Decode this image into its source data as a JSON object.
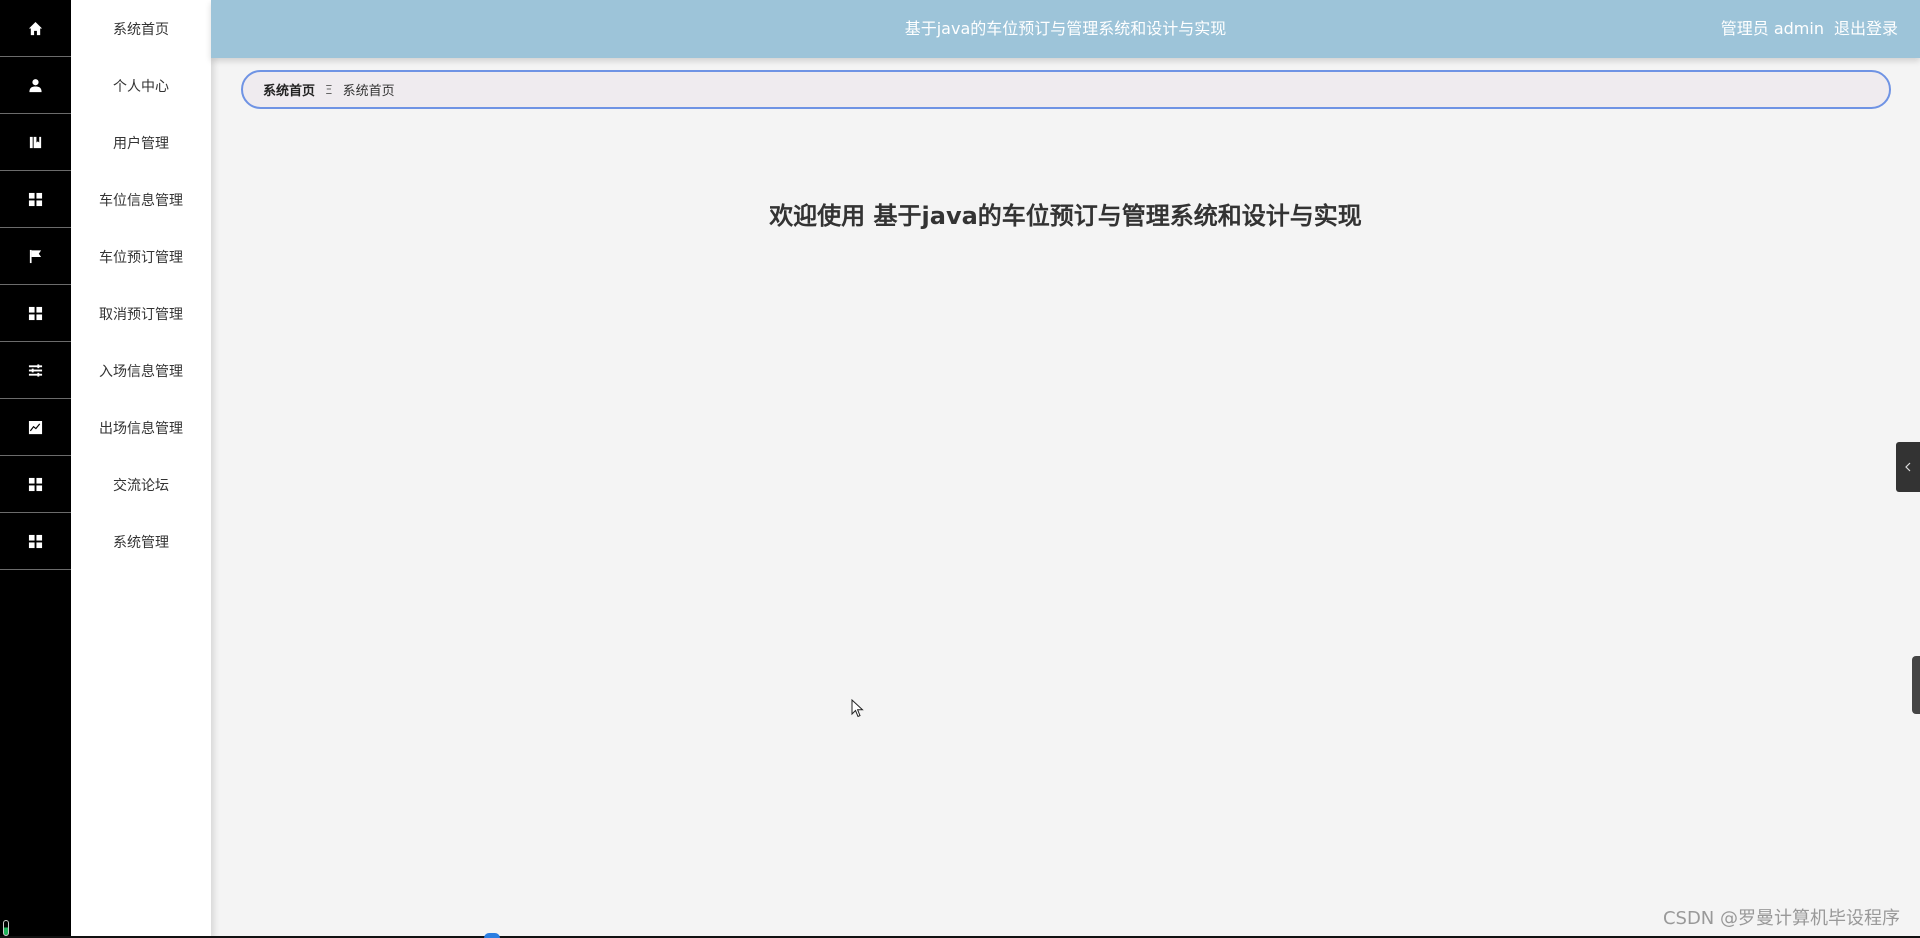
{
  "header": {
    "title": "基于java的车位预订与管理系统和设计与实现",
    "user_label": "管理员 admin",
    "logout_label": "退出登录",
    "background_color": "#9dc4d9"
  },
  "sidebar": {
    "items": [
      {
        "label": "系统首页",
        "icon": "home-icon"
      },
      {
        "label": "个人中心",
        "icon": "user-icon"
      },
      {
        "label": "用户管理",
        "icon": "book-icon"
      },
      {
        "label": "车位信息管理",
        "icon": "grid-icon"
      },
      {
        "label": "车位预订管理",
        "icon": "flag-icon"
      },
      {
        "label": "取消预订管理",
        "icon": "grid-icon"
      },
      {
        "label": "入场信息管理",
        "icon": "sliders-icon"
      },
      {
        "label": "出场信息管理",
        "icon": "chart-icon"
      },
      {
        "label": "交流论坛",
        "icon": "grid-icon"
      },
      {
        "label": "系统管理",
        "icon": "grid-icon"
      }
    ]
  },
  "breadcrumb": {
    "first": "系统首页",
    "separator": "Ξ",
    "current": "系统首页",
    "border_color": "#6f93e4"
  },
  "main": {
    "welcome": "欢迎使用 基于java的车位预订与管理系统和设计与实现"
  },
  "watermark": "CSDN @罗曼计算机毕设程序"
}
